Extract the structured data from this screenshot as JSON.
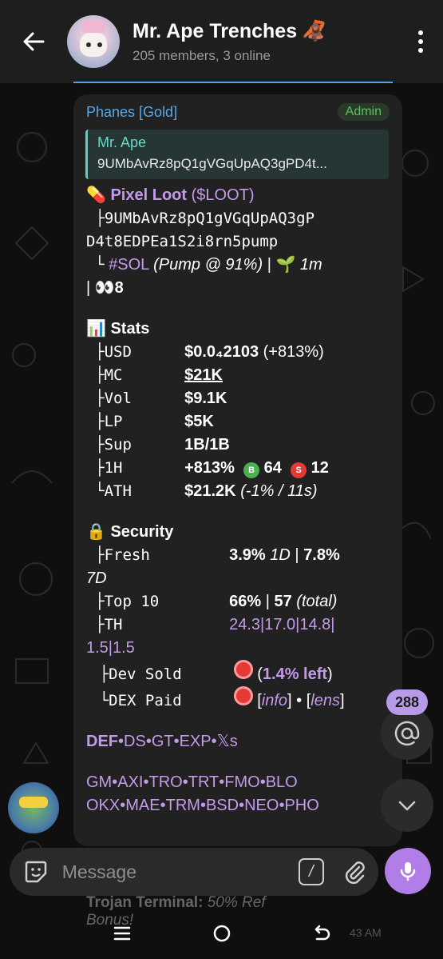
{
  "header": {
    "title": "Mr. Ape Trenches",
    "title_emoji": "🦧",
    "subtitle": "205 members, 3 online"
  },
  "message": {
    "sender": "Phanes [Gold]",
    "badge": "Admin",
    "reply": {
      "name": "Mr. Ape",
      "text": "9UMbAvRz8pQ1gVGqUpAQ3gPD4t..."
    },
    "token": {
      "emoji": "💊",
      "name": "Pixel Loot",
      "ticker": "($LOOT)",
      "address_line1_prefix": "├",
      "address_line1": "9UMbAvRz8pQ1gVGqUpAQ3gP",
      "address_line2": "D4t8EDPEa1S2i8rn5pump",
      "chain_prefix": "└",
      "chain": "#SOL",
      "pump_info": "(Pump @ 91%)",
      "sep": "|",
      "age_emoji": "🌱",
      "age": "1m",
      "sep2": "|",
      "eyes_emoji": "👀",
      "eyes_count": "8"
    },
    "stats": {
      "emoji": "📊",
      "title": "Stats",
      "rows": [
        {
          "prefix": "├",
          "label": "USD",
          "value": "$0.0₄2103",
          "extra": "(+813%)"
        },
        {
          "prefix": "├",
          "label": "MC",
          "value": "$21K",
          "extra": ""
        },
        {
          "prefix": "├",
          "label": "Vol",
          "value": "$9.1K",
          "extra": ""
        },
        {
          "prefix": "├",
          "label": "LP",
          "value": "$5K",
          "extra": ""
        },
        {
          "prefix": "├",
          "label": "Sup",
          "value": "1B/1B",
          "extra": ""
        },
        {
          "prefix": "├",
          "label": "1H",
          "value": "+813%",
          "extra": ""
        },
        {
          "prefix": "└",
          "label": "ATH",
          "value": "$21.2K",
          "extra": "(-1% / 11s)"
        }
      ],
      "buys_label": "B",
      "buys": "64",
      "sells_label": "S",
      "sells": "12"
    },
    "security": {
      "emoji": "🔒",
      "title": "Security",
      "fresh_prefix": "├",
      "fresh_label": "Fresh",
      "fresh_value": "3.9%",
      "fresh_1d": "1D",
      "fresh_sep": "|",
      "fresh_value2": "7.8%",
      "fresh_7d": "7D",
      "top10_prefix": "├",
      "top10_label": "Top 10",
      "top10_value": "66%",
      "top10_sep": "|",
      "top10_total": "57",
      "top10_total_label": "(total)",
      "th_prefix": "├",
      "th_label": "TH",
      "th_values_line1": "24.3|17.0|14.8|",
      "th_values_line2": "1.5|1.5",
      "devsold_prefix": "├",
      "devsold_label": "Dev Sold",
      "devsold_pct": "1.4% left",
      "dexpaid_prefix": "└",
      "dexpaid_label": "DEX Paid",
      "dexpaid_info": "info",
      "dexpaid_lens": "lens"
    },
    "links1": [
      "DEF",
      "DS",
      "GT",
      "EXP",
      "𝕏s"
    ],
    "links2": [
      "GM",
      "AXI",
      "TRO",
      "TRT",
      "FMO",
      "BLO"
    ],
    "links3": [
      "OKX",
      "MAE",
      "TRM",
      "BSD",
      "NEO",
      "PHO"
    ]
  },
  "mention_count": "288",
  "composer": {
    "placeholder": "Message"
  },
  "peek": {
    "text_bold": "Trojan Terminal:",
    "text_italic": "50% Ref",
    "text2": "Bonus!",
    "time": "43 AM"
  },
  "colors": {
    "accent_purple": "#c49be8",
    "link_blue": "#5aa8e6",
    "admin_green": "#5cc15c",
    "mic_bg": "#b07ee6"
  }
}
